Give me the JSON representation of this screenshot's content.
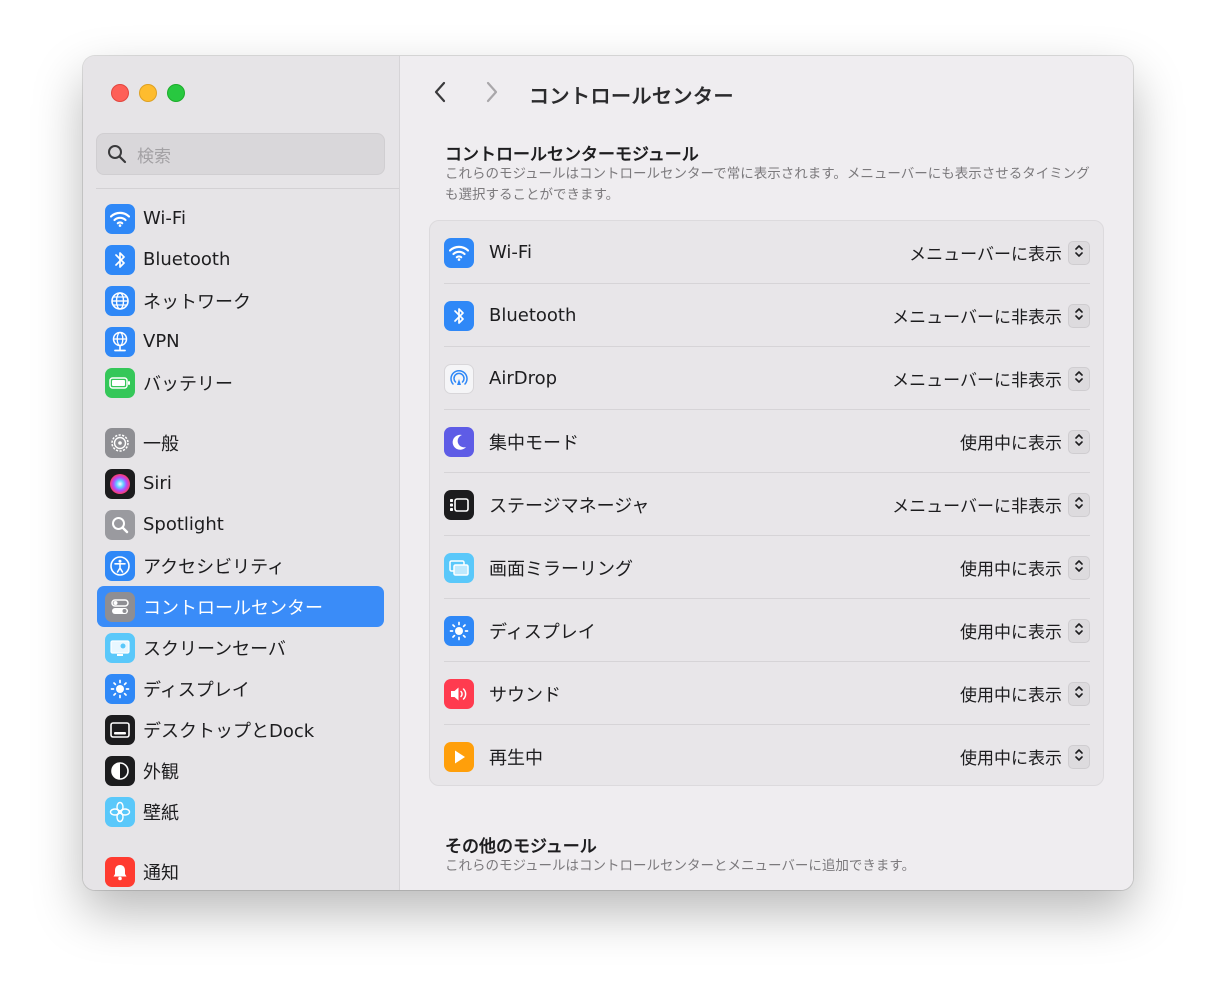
{
  "window": {
    "sidebar": {
      "search_placeholder": "検索",
      "groups": [
        [
          {
            "label": "Wi-Fi",
            "icon": "wifi-icon",
            "color": "#2f88f7"
          },
          {
            "label": "Bluetooth",
            "icon": "bluetooth-icon",
            "color": "#2f88f7"
          },
          {
            "label": "ネットワーク",
            "icon": "globe-icon",
            "color": "#2f88f7"
          },
          {
            "label": "VPN",
            "icon": "vpn-globe-icon",
            "color": "#2f88f7"
          },
          {
            "label": "バッテリー",
            "icon": "battery-icon",
            "color": "#35c759"
          }
        ],
        [
          {
            "label": "一般",
            "icon": "gear-icon",
            "color": "#8e8e93"
          },
          {
            "label": "Siri",
            "icon": "siri-icon",
            "color": "#1c1c1e"
          },
          {
            "label": "Spotlight",
            "icon": "magnifier-icon",
            "color": "#9a9a9f"
          },
          {
            "label": "アクセシビリティ",
            "icon": "accessibility-icon",
            "color": "#2f88f7"
          },
          {
            "label": "コントロールセンター",
            "icon": "control-center-icon",
            "color": "#8e8e93",
            "selected": true
          },
          {
            "label": "スクリーンセーバ",
            "icon": "screensaver-icon",
            "color": "#5ac8fa"
          },
          {
            "label": "ディスプレイ",
            "icon": "sun-icon",
            "color": "#2f88f7"
          },
          {
            "label": "デスクトップとDock",
            "icon": "dock-icon",
            "color": "#1c1c1e"
          },
          {
            "label": "外観",
            "icon": "appearance-icon",
            "color": "#1c1c1e"
          },
          {
            "label": "壁紙",
            "icon": "flower-icon",
            "color": "#5ac8fa"
          }
        ],
        [
          {
            "label": "通知",
            "icon": "bell-icon",
            "color": "#ff3b30"
          }
        ]
      ]
    },
    "main": {
      "title": "コントロールセンター",
      "section1": {
        "title": "コントロールセンターモジュール",
        "description": "これらのモジュールはコントロールセンターで常に表示されます。メニューバーにも表示させるタイミングも選択することができます。"
      },
      "modules": [
        {
          "label": "Wi-Fi",
          "value": "メニューバーに表示",
          "icon": "wifi-icon",
          "color": "#2f88f7"
        },
        {
          "label": "Bluetooth",
          "value": "メニューバーに非表示",
          "icon": "bluetooth-icon",
          "color": "#2f88f7"
        },
        {
          "label": "AirDrop",
          "value": "メニューバーに非表示",
          "icon": "airdrop-icon",
          "color": "#f5f5f7"
        },
        {
          "label": "集中モード",
          "value": "使用中に表示",
          "icon": "moon-icon",
          "color": "#5e5ce6"
        },
        {
          "label": "ステージマネージャ",
          "value": "メニューバーに非表示",
          "icon": "stage-manager-icon",
          "color": "#1c1c1e"
        },
        {
          "label": "画面ミラーリング",
          "value": "使用中に表示",
          "icon": "screen-mirroring-icon",
          "color": "#5ac8fa"
        },
        {
          "label": "ディスプレイ",
          "value": "使用中に表示",
          "icon": "sun-icon",
          "color": "#2f88f7"
        },
        {
          "label": "サウンド",
          "value": "使用中に表示",
          "icon": "speaker-icon",
          "color": "#ff3b4f"
        },
        {
          "label": "再生中",
          "value": "使用中に表示",
          "icon": "play-icon",
          "color": "#ff9f0a"
        }
      ],
      "section2": {
        "title": "その他のモジュール",
        "description": "これらのモジュールはコントロールセンターとメニューバーに追加できます。"
      }
    }
  }
}
